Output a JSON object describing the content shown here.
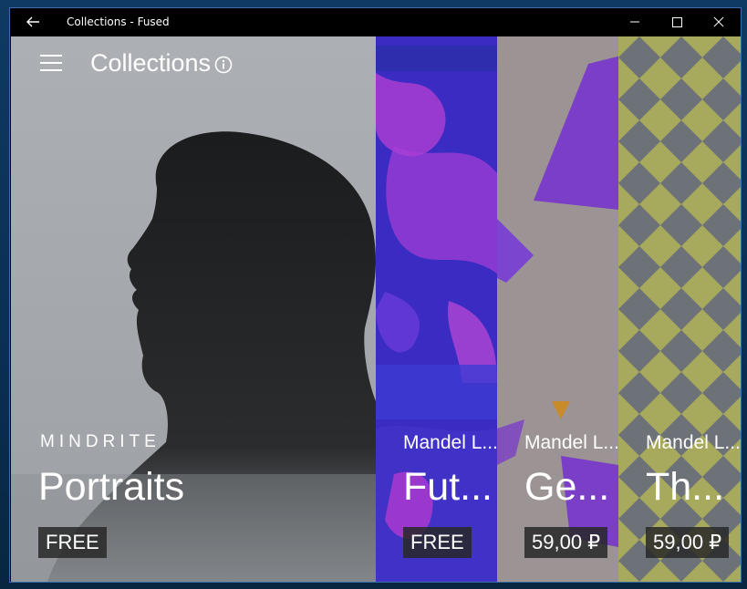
{
  "window": {
    "title": "Collections - Fused"
  },
  "header": {
    "title": "Collections"
  },
  "collections": [
    {
      "publisher": "MINDRITE",
      "title": "Portraits",
      "price": "FREE"
    },
    {
      "publisher": "Mandel L...",
      "title": "Fut...",
      "price": "FREE"
    },
    {
      "publisher": "Mandel L...",
      "title": "Ge...",
      "price": "59,00 ₽"
    },
    {
      "publisher": "Mandel L...",
      "title": "Th...",
      "price": "59,00 ₽"
    }
  ],
  "colors": {
    "titlebar": "#000000",
    "portraits_bg": "#a7abaf",
    "futures_bg": "#3a2bc2",
    "geo_bg": "#9a9292",
    "th_bg": "#a6a85a",
    "price_badge": "#282828"
  }
}
